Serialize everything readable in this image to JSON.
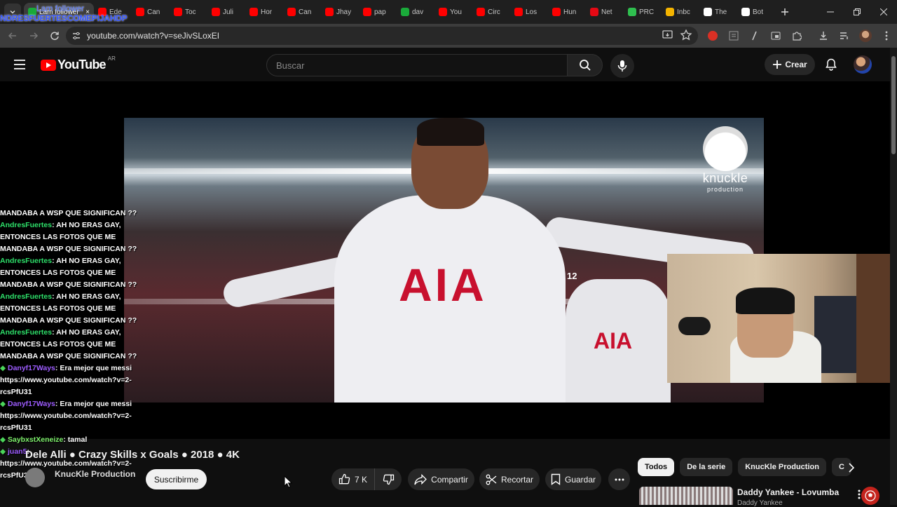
{
  "browser": {
    "overlay_top_text": "Lam follower",
    "overlay_title": "NDRESFUERTESCOMEPIJAHDP",
    "tabs": [
      {
        "label": "Lam follower",
        "color": "#1aaa3a",
        "active": true
      },
      {
        "label": "Ede",
        "color": "#ff0000"
      },
      {
        "label": "Can",
        "color": "#ff0000"
      },
      {
        "label": "Toc",
        "color": "#ff0000"
      },
      {
        "label": "Juli",
        "color": "#ff0000"
      },
      {
        "label": "Hor",
        "color": "#ff0000"
      },
      {
        "label": "Can",
        "color": "#ff0000"
      },
      {
        "label": "Jhay",
        "color": "#ff0000"
      },
      {
        "label": "pap",
        "color": "#ff0000"
      },
      {
        "label": "dav",
        "color": "#1aaa3a"
      },
      {
        "label": "You",
        "color": "#ff0000"
      },
      {
        "label": "Circ",
        "color": "#ff0000"
      },
      {
        "label": "Los",
        "color": "#ff0000"
      },
      {
        "label": "Hun",
        "color": "#ff0000"
      },
      {
        "label": "Net",
        "color": "#e50914"
      },
      {
        "label": "PRC",
        "color": "#2fbf4f"
      },
      {
        "label": "Inbc",
        "color": "#f4b400"
      },
      {
        "label": "The",
        "color": "#ffffff"
      },
      {
        "label": "Bot",
        "color": "#ffffff"
      }
    ],
    "url": "youtube.com/watch?v=seJivSLoxEI"
  },
  "masthead": {
    "logo_text": "YouTube",
    "country_code": "AR",
    "search_placeholder": "Buscar",
    "create_label": "Crear"
  },
  "video": {
    "watermark_brand": "knuckle",
    "watermark_sub": "production",
    "kit_sponsor": "AIA",
    "badge": "12",
    "title": "Dele Alli ● Crazy Skills x Goals ● 2018 ● 4K",
    "channel": "KnucKle Production",
    "subscribe_label": "Suscribirme",
    "likes": "7 K",
    "share_label": "Compartir",
    "clip_label": "Recortar",
    "save_label": "Guardar"
  },
  "chat": [
    {
      "user": "",
      "text": "MANDABA A WSP QUE SIGNIFICAN ??"
    },
    {
      "user": "AndresFuertes",
      "text": ": AH NO ERAS GAY, ENTONCES LAS FOTOS QUE ME MANDABA A WSP QUE SIGNIFICAN ??"
    },
    {
      "user": "AndresFuertes",
      "text": ": AH NO ERAS GAY, ENTONCES LAS FOTOS QUE ME MANDABA A WSP QUE SIGNIFICAN ??"
    },
    {
      "user": "AndresFuertes",
      "text": ": AH NO ERAS GAY, ENTONCES LAS FOTOS QUE ME MANDABA A WSP QUE SIGNIFICAN ??"
    },
    {
      "user": "AndresFuertes",
      "text": ": AH NO ERAS GAY, ENTONCES LAS FOTOS QUE ME MANDABA A WSP QUE SIGNIFICAN ??"
    },
    {
      "user": "Danyf17Ways",
      "text": ": Era mejor que messi https://www.youtube.com/watch?v=2-rcsPfU31",
      "style": "purple"
    },
    {
      "user": "Danyf17Ways",
      "text": ": Era mejor que messi https://www.youtube.com/watch?v=2-rcsPfU31",
      "style": "purple"
    },
    {
      "user": "SaybxstXeneize",
      "text": ": tamal",
      "style": "lime"
    },
    {
      "user": "juan5",
      "text": ": https://www.youtube.com/watch?v=2-rcsPfU31",
      "style": "purple"
    }
  ],
  "sidebar": {
    "chips": [
      "Todos",
      "De la serie",
      "KnucKle Production",
      "C"
    ],
    "rec_title": "Daddy Yankee - Lovumba",
    "rec_channel": "Daddy Yankee"
  },
  "icons": [
    "menu-icon",
    "search-icon",
    "mic-icon",
    "plus-icon",
    "bell-icon",
    "like-icon",
    "dislike-icon",
    "share-icon",
    "scissors-icon",
    "bookmark-icon",
    "more-icon",
    "chevron-right-icon"
  ]
}
